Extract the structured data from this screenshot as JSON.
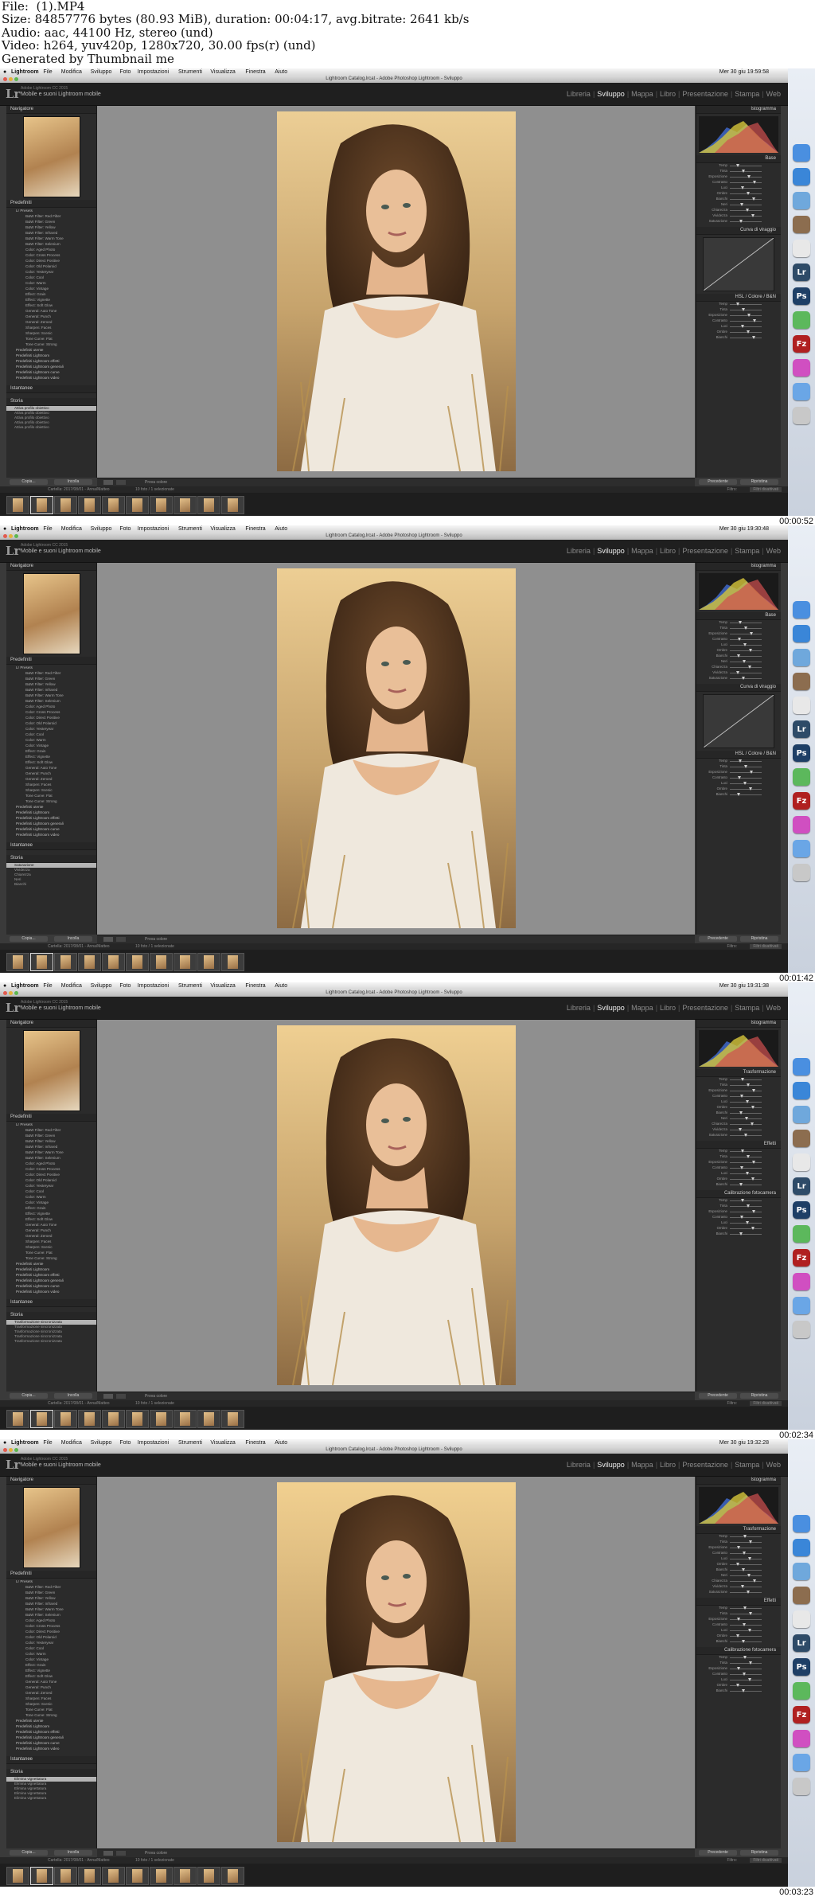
{
  "header": {
    "lines": [
      "File:  (1).MP4",
      "Size: 84857776 bytes (80.93 MiB), duration: 00:04:17, avg.bitrate: 2641 kb/s",
      "Audio: aac, 44100 Hz, stereo (und)",
      "Video: h264, yuv420p, 1280x720, 30.00 fps(r) (und)",
      "Generated by Thumbnail me"
    ]
  },
  "colors": {
    "background": "#ffffff",
    "lr_dark": "#2b2b2b",
    "canvas_grey": "#8f8f8f",
    "module_active": "#f2f2f2"
  },
  "app": {
    "menu": [
      "Lightroom",
      "File",
      "Modifica",
      "Sviluppo",
      "Foto",
      "Impostazioni",
      "Strumenti",
      "Visualizza",
      "Finestra",
      "Aiuto"
    ],
    "window_title": "Lightroom Catalog.lrcat - Adobe Photoshop Lightroom - Sviluppo",
    "identity_line1": "Adobe Lightroom CC 2015",
    "identity_line2": "Mobile e suoni Lightroom mobile",
    "modules": [
      "Libreria",
      "Sviluppo",
      "Mappa",
      "Libro",
      "Presentazione",
      "Stampa",
      "Web"
    ],
    "active_module": "Sviluppo",
    "left_panels": {
      "navigator": "Navigatore",
      "presets": "Predefiniti",
      "snapshots": "Istantanee",
      "history": "Storia"
    },
    "preset_folder": "Lr Presets",
    "presets": [
      "B&W Filter: Red Filter",
      "B&W Filter: Green",
      "B&W Filter: Yellow",
      "B&W Filter: Infrared",
      "B&W Filter: Warm Tone",
      "B&W Filter: Selenium",
      "Color: Aged Photo",
      "Color: Cross Process",
      "Color: Direct Positive",
      "Color: Old Polaroid",
      "Color: Yesteryear",
      "Color: Cool",
      "Color: Warm",
      "Color: Vintage",
      "Effect: Grain",
      "Effect: Vignette",
      "Effect: Soft Glow",
      "General: Auto Tone",
      "General: Punch",
      "General: Zeroed",
      "Sharpen: Faces",
      "Sharpen: Scenic",
      "Tone Curve: Flat",
      "Tone Curve: Strong"
    ],
    "user_presets": [
      "Predefiniti utente",
      "Predefiniti Lightroom",
      "Predefiniti Lightroom effetti",
      "Predefiniti Lightroom generali",
      "Predefiniti Lightroom curve",
      "Predefiniti Lightroom video"
    ],
    "left_buttons": {
      "copy": "Copia...",
      "paste": "Incolla"
    },
    "right_panels": {
      "histogram": "Istogramma",
      "basic": "Base",
      "tone_curve": "Curva di viraggio",
      "hsl": "HSL / Colore / B&N",
      "transform": "Trasformazione",
      "effects": "Effetti",
      "calibration": "Calibrazione fotocamera"
    },
    "basic_sliders": [
      "Temp",
      "Tinta",
      "Esposizione",
      "Contrasto",
      "Luci",
      "Ombre",
      "Bianchi",
      "Neri",
      "Chiarezza",
      "Vividezza",
      "Saturazione"
    ],
    "right_buttons": {
      "previous": "Precedente",
      "reset": "Ripristina"
    },
    "toolbar_label": "Prova colore",
    "filmstrip_label": "Cartella: 2017/08/01 - Anna/Matteo",
    "filmstrip_count": "10 foto / 1 selezionate",
    "filmstrip_filter": "Filtro:",
    "filmstrip_filter_value": "Filtri disattivati"
  },
  "frames": [
    {
      "timestamp": "00:00:52",
      "clock": "Mer 30 giu 19:59:58",
      "history_items": [
        "Attiva profilo obiettivo",
        "Attiva profilo obiettivo",
        "Attiva profilo obiettivo",
        "Attiva profilo obiettivo",
        "Attiva profilo obiettivo"
      ],
      "selected_history": 0,
      "warmth": 0.55
    },
    {
      "timestamp": "00:01:42",
      "clock": "Mer 30 giu 19:30:48",
      "history_items": [
        "Saturazione",
        "Vividezza",
        "Chiarezza",
        "Neri",
        "Bianchi"
      ],
      "selected_history": 0,
      "warmth": 0.62
    },
    {
      "timestamp": "00:02:34",
      "clock": "Mer 30 giu 19:31:38",
      "history_items": [
        "Trasformazione sincronizzata",
        "Trasformazione sincronizzata",
        "Trasformazione sincronizzata",
        "Trasformazione sincronizzata",
        "Trasformazione sincronizzata"
      ],
      "selected_history": 0,
      "warmth": 0.7
    },
    {
      "timestamp": "00:03:23",
      "clock": "Mer 30 giu 19:32:28",
      "history_items": [
        "Elimina vignettatura",
        "Elimina vignettatura",
        "Elimina vignettatura",
        "Elimina vignettatura",
        "Elimina vignettatura"
      ],
      "selected_history": 0,
      "warmth": 0.78
    }
  ]
}
